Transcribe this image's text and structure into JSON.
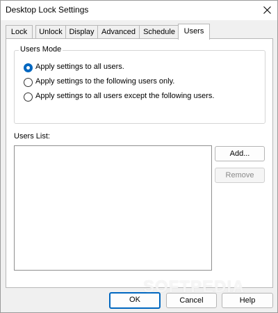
{
  "window": {
    "title": "Desktop Lock Settings"
  },
  "tabs": [
    {
      "label": "Lock"
    },
    {
      "label": "Unlock"
    },
    {
      "label": "Display"
    },
    {
      "label": "Advanced"
    },
    {
      "label": "Schedule"
    },
    {
      "label": "Users",
      "active": true
    }
  ],
  "users_mode": {
    "label": "Users Mode",
    "options": [
      {
        "label": "Apply settings to all users.",
        "checked": true
      },
      {
        "label": "Apply settings to the following users only.",
        "checked": false
      },
      {
        "label": "Apply settings to all users except the following users.",
        "checked": false
      }
    ]
  },
  "users_list": {
    "label": "Users List:",
    "items": [],
    "add_label": "Add...",
    "remove_label": "Remove"
  },
  "footer": {
    "ok_label": "OK",
    "cancel_label": "Cancel",
    "help_label": "Help"
  },
  "watermark": "SOFTPEDIA",
  "colors": {
    "accent": "#0067c0"
  }
}
